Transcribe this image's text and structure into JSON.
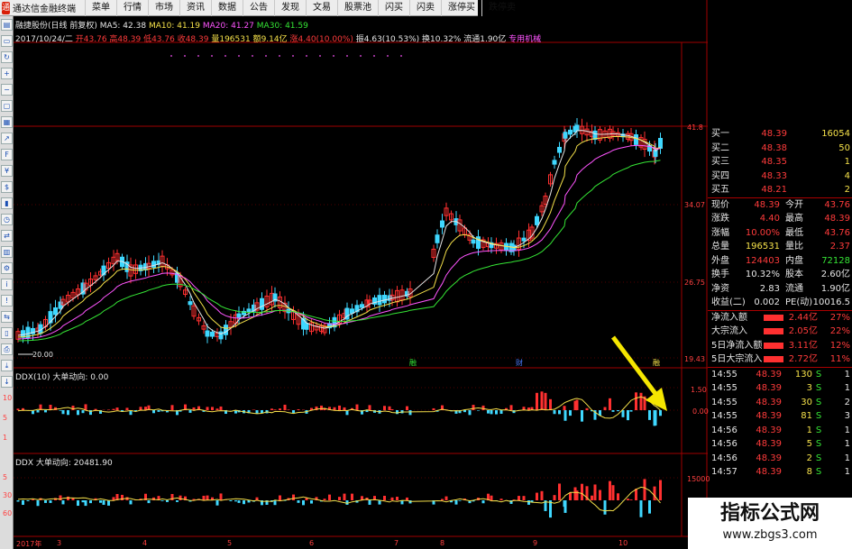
{
  "menubar": {
    "app_title": "通达信金融终端",
    "items": [
      "菜单",
      "行情",
      "市场",
      "资讯",
      "数据",
      "公告",
      "发现",
      "文易",
      "股票池",
      "闪买",
      "闪卖",
      "涨停买",
      "跌停卖"
    ]
  },
  "toolbar": {
    "icons": [
      "chart-icon",
      "ruler-icon",
      "refresh-icon",
      "zoom-in-icon",
      "zoom-out-icon",
      "window-icon",
      "tile-icon",
      "trend-icon",
      "f10-icon",
      "fund-icon",
      "price-icon",
      "volume-icon",
      "history-icon",
      "compare-icon",
      "layout-icon",
      "tools-icon",
      "info-icon",
      "risk-icon",
      "exchange-icon",
      "page-icon",
      "print-icon",
      "export-icon",
      "down-icon"
    ]
  },
  "header": {
    "stock": "融捷股份(日线 前复权)",
    "ma5": "MA5: 42.38",
    "ma10": "MA10: 41.19",
    "ma20": "MA20: 41.27",
    "ma30": "MA30: 41.59",
    "date": "2017/10/24/二",
    "open": "开43.76",
    "high": "高48.39",
    "low": "低43.76",
    "close": "收48.39",
    "volume": "量196531",
    "amount": "额9.14亿",
    "change": "涨4.40(10.00%)",
    "amplitude": "振4.63(10.53%)",
    "turnover": "换10.32%",
    "float": "流通1.90亿",
    "sector": "专用机械"
  },
  "price_axis": [
    "41.8",
    "34.07",
    "26.75",
    "19.43"
  ],
  "price_low_label": "20.00",
  "event_markers": [
    "融",
    "财",
    "融"
  ],
  "ddx": {
    "label": "DDX(10) 大单动向: 0.00",
    "axis": [
      "1.50",
      "0.00"
    ],
    "left_axis": [
      "10",
      "5",
      "1"
    ]
  },
  "ddx2": {
    "label": "DDX 大单动向: 20481.90",
    "axis": [
      "15000"
    ],
    "left_axis": [
      "5",
      "30",
      "60"
    ]
  },
  "dates": [
    "2017年",
    "3",
    "4",
    "5",
    "6",
    "7",
    "8",
    "9",
    "10"
  ],
  "order_book": [
    {
      "label": "买一",
      "price": "48.39",
      "vol": "16054"
    },
    {
      "label": "买二",
      "price": "48.38",
      "vol": "50"
    },
    {
      "label": "买三",
      "price": "48.35",
      "vol": "1"
    },
    {
      "label": "买四",
      "price": "48.33",
      "vol": "4"
    },
    {
      "label": "买五",
      "price": "48.21",
      "vol": "2"
    }
  ],
  "quote": [
    {
      "k": "现价",
      "v": "48.39",
      "vc": "#ff3b3b",
      "k2": "今开",
      "v2": "43.76",
      "v2c": "#ff3b3b"
    },
    {
      "k": "涨跌",
      "v": "4.40",
      "vc": "#ff3b3b",
      "k2": "最高",
      "v2": "48.39",
      "v2c": "#ff3b3b"
    },
    {
      "k": "涨幅",
      "v": "10.00%",
      "vc": "#ff3b3b",
      "k2": "最低",
      "v2": "43.76",
      "v2c": "#ff3b3b"
    },
    {
      "k": "总量",
      "v": "196531",
      "vc": "#f5e14a",
      "k2": "量比",
      "v2": "2.37",
      "v2c": "#ff3b3b"
    },
    {
      "k": "外盘",
      "v": "124403",
      "vc": "#ff3b3b",
      "k2": "内盘",
      "v2": "72128",
      "v2c": "#35e535"
    },
    {
      "k": "换手",
      "v": "10.32%",
      "vc": "#e6e6e6",
      "k2": "股本",
      "v2": "2.60亿",
      "v2c": "#e6e6e6"
    },
    {
      "k": "净资",
      "v": "2.83",
      "vc": "#e6e6e6",
      "k2": "流通",
      "v2": "1.90亿",
      "v2c": "#e6e6e6"
    },
    {
      "k": "收益(二)",
      "v": "0.002",
      "vc": "#e6e6e6",
      "k2": "PE(动)",
      "v2": "10016.5",
      "v2c": "#e6e6e6"
    }
  ],
  "fund_flow": [
    {
      "k": "净流入额",
      "v": "2.44亿",
      "p": "27%"
    },
    {
      "k": "大宗流入",
      "v": "2.05亿",
      "p": "22%"
    },
    {
      "k": "5日净流入额",
      "v": "3.11亿",
      "p": "12%"
    },
    {
      "k": "5日大宗流入",
      "v": "2.72亿",
      "p": "11%"
    }
  ],
  "ticks": [
    {
      "t": "14:55",
      "p": "48.39",
      "q": "130",
      "s": "S",
      "n": "1"
    },
    {
      "t": "14:55",
      "p": "48.39",
      "q": "3",
      "s": "S",
      "n": "1"
    },
    {
      "t": "14:55",
      "p": "48.39",
      "q": "30",
      "s": "S",
      "n": "2"
    },
    {
      "t": "14:55",
      "p": "48.39",
      "q": "81",
      "s": "S",
      "n": "3"
    },
    {
      "t": "14:56",
      "p": "48.39",
      "q": "1",
      "s": "S",
      "n": "1"
    },
    {
      "t": "14:56",
      "p": "48.39",
      "q": "5",
      "s": "S",
      "n": "1"
    },
    {
      "t": "14:56",
      "p": "48.39",
      "q": "2",
      "s": "S",
      "n": "1"
    },
    {
      "t": "14:57",
      "p": "48.39",
      "q": "8",
      "s": "S",
      "n": "1"
    }
  ],
  "watermark": {
    "title": "指标公式网",
    "url": "www.zbgs3.com"
  },
  "colors": {
    "up": "#ff3030",
    "down": "#3fd8ff",
    "ma5": "#e6e6e6",
    "ma10": "#f5e14a",
    "ma20": "#ff55ff",
    "ma30": "#35e535",
    "grid": "#a00000"
  }
}
